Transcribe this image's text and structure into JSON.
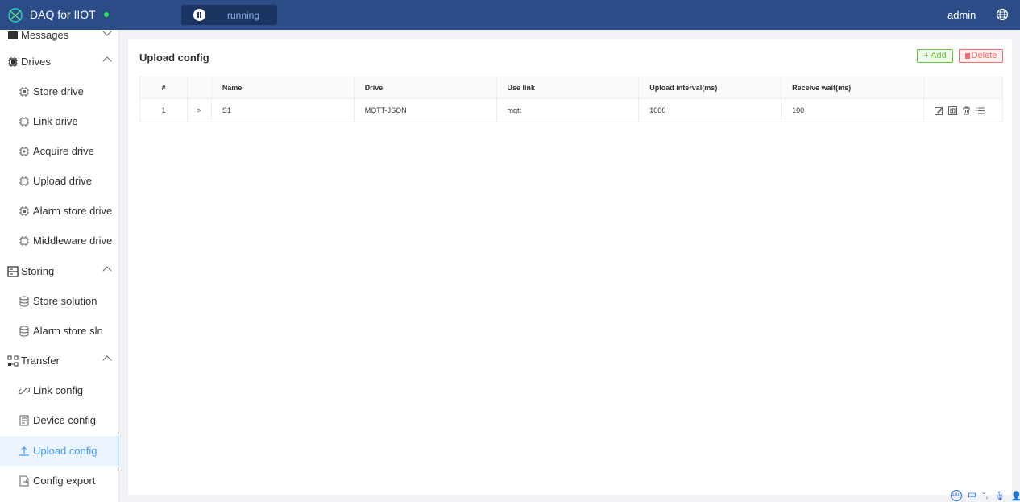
{
  "header": {
    "app_title": "DAQ for IIOT",
    "status_label": "running",
    "user": "admin"
  },
  "sidebar": {
    "partial_item": "Messages",
    "groups": [
      {
        "label": "Drives",
        "items": [
          "Store drive",
          "Link drive",
          "Acquire drive",
          "Upload drive",
          "Alarm store drive",
          "Middleware drive"
        ]
      },
      {
        "label": "Storing",
        "items": [
          "Store solution",
          "Alarm store sln"
        ]
      },
      {
        "label": "Transfer",
        "items": [
          "Link config",
          "Device config",
          "Upload config",
          "Config export"
        ]
      }
    ],
    "active_item": "Upload config"
  },
  "main": {
    "title": "Upload config",
    "add_label": "+ Add",
    "delete_label": "Delete",
    "table": {
      "headers": [
        "#",
        "",
        "Name",
        "Drive",
        "Use link",
        "Upload interval(ms)",
        "Receive wait(ms)",
        ""
      ],
      "rows": [
        {
          "index": "1",
          "expand": ">",
          "name": "S1",
          "drive": "MQTT-JSON",
          "use_link": "mqtt",
          "upload_interval": "1000",
          "receive_wait": "100"
        }
      ]
    }
  },
  "tray": {
    "ime": "中"
  },
  "colors": {
    "header_bg": "#2b4c86",
    "accent": "#409eff",
    "success": "#67c23a",
    "danger": "#f56c6c"
  }
}
